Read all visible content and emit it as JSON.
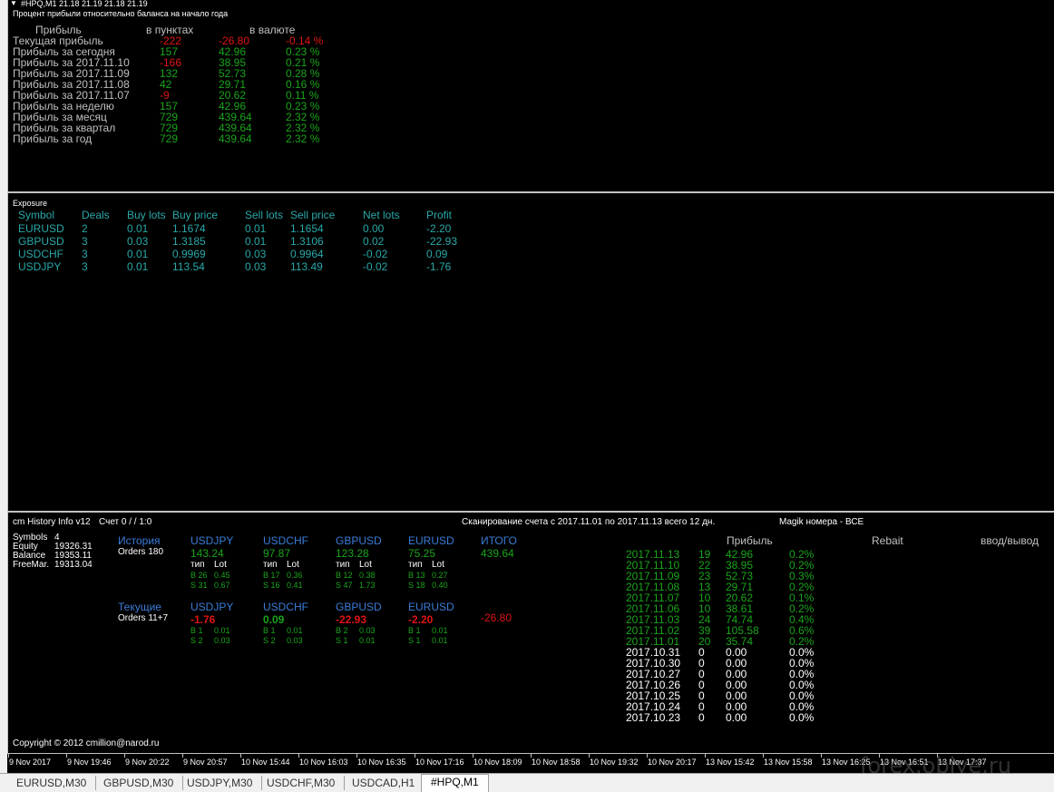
{
  "pane1": {
    "title": "#HPQ,M1  21.18 21.19 21.18 21.19",
    "subtitle": "Процент прибыли относительно баланса на начало года",
    "col_profit": "Прибыль",
    "col_points": "в пунктах",
    "col_currency": "в валюте",
    "rows": [
      {
        "label": "Текущая прибыль",
        "points": "-222",
        "money": "-26.80",
        "pct": "-0.14 %",
        "neg": true
      },
      {
        "label": "Прибыль за сегодня",
        "points": "157",
        "money": "42.96",
        "pct": "0.23 %",
        "neg": false
      },
      {
        "label": "Прибыль за 2017.11.10",
        "points": "-166",
        "money": "38.95",
        "pct": "0.21 %",
        "neg": false,
        "neg_points": true
      },
      {
        "label": "Прибыль за 2017.11.09",
        "points": "132",
        "money": "52.73",
        "pct": "0.28 %",
        "neg": false
      },
      {
        "label": "Прибыль за 2017.11.08",
        "points": "42",
        "money": "29.71",
        "pct": "0.16 %",
        "neg": false
      },
      {
        "label": "Прибыль за 2017.11.07",
        "points": "-9",
        "money": "20.62",
        "pct": "0.11 %",
        "neg": false,
        "neg_points": true
      },
      {
        "label": "Прибыль за неделю",
        "points": "157",
        "money": "42.96",
        "pct": "0.23 %",
        "neg": false
      },
      {
        "label": "Прибыль за месяц",
        "points": "729",
        "money": "439.64",
        "pct": "2.32 %",
        "neg": false
      },
      {
        "label": "Прибыль за квартал",
        "points": "729",
        "money": "439.64",
        "pct": "2.32 %",
        "neg": false
      },
      {
        "label": "Прибыль за год",
        "points": "729",
        "money": "439.64",
        "pct": "2.32 %",
        "neg": false
      }
    ]
  },
  "pane2": {
    "title": "Exposure",
    "headers": [
      "Symbol",
      "Deals",
      "Buy lots",
      "Buy price",
      "Sell lots",
      "Sell price",
      "Net lots",
      "Profit"
    ],
    "rows": [
      [
        "EURUSD",
        "2",
        "0.01",
        "1.1674",
        "0.01",
        "1.1654",
        "0.00",
        "-2.20"
      ],
      [
        "GBPUSD",
        "3",
        "0.03",
        "1.3185",
        "0.01",
        "1.3106",
        "0.02",
        "-22.93"
      ],
      [
        "USDCHF",
        "3",
        "0.01",
        "0.9969",
        "0.03",
        "0.9964",
        "-0.02",
        "0.09"
      ],
      [
        "USDJPY",
        "3",
        "0.01",
        "113.54",
        "0.03",
        "113.49",
        "-0.02",
        "-1.76"
      ]
    ]
  },
  "pane3": {
    "title": "cm History Info v12",
    "counter": "Счет 0 /  / 1:0",
    "scan": "Сканирование счета с 2017.11.01 по 2017.11.13 всего 12 дн.",
    "magic": "Magik номера - ВСЕ",
    "account": [
      {
        "label": "Symbols",
        "value": "4"
      },
      {
        "label": "Equity",
        "value": "19326.31"
      },
      {
        "label": "Balance",
        "value": "19353.11"
      },
      {
        "label": "FreeMar.",
        "value": "19313.04"
      }
    ],
    "history_label": "История",
    "history_orders": "Orders 180",
    "current_label": "Текущие",
    "current_orders": "Orders 11+7",
    "type_label": "тип",
    "lot_label": "Lot",
    "total_label": "ИТОГО",
    "history_total": "439.64",
    "current_total": "-26.80",
    "history": [
      {
        "sym": "USDJPY",
        "profit": "143.24",
        "b": "B 26",
        "bl": "0.45",
        "s": "S 31",
        "sl": "0.67"
      },
      {
        "sym": "USDCHF",
        "profit": "97.87",
        "b": "B 17",
        "bl": "0.36",
        "s": "S 16",
        "sl": "0.41"
      },
      {
        "sym": "GBPUSD",
        "profit": "123.28",
        "b": "B 12",
        "bl": "0.38",
        "s": "S 47",
        "sl": "1.73"
      },
      {
        "sym": "EURUSD",
        "profit": "75.25",
        "b": "B 13",
        "bl": "0.27",
        "s": "S 18",
        "sl": "0.40"
      }
    ],
    "current": [
      {
        "sym": "USDJPY",
        "profit": "-1.76",
        "neg": true,
        "b": "B 1",
        "bl": "0.01",
        "s": "S 2",
        "sl": "0.03"
      },
      {
        "sym": "USDCHF",
        "profit": "0.09",
        "neg": false,
        "b": "B 1",
        "bl": "0.01",
        "s": "S 2",
        "sl": "0.03"
      },
      {
        "sym": "GBPUSD",
        "profit": "-22.93",
        "neg": true,
        "b": "B 2",
        "bl": "0.03",
        "s": "S 1",
        "sl": "0.01"
      },
      {
        "sym": "EURUSD",
        "profit": "-2.20",
        "neg": true,
        "b": "B 1",
        "bl": "0.01",
        "s": "S 1",
        "sl": "0.01"
      }
    ],
    "daily_header": "Прибыль",
    "rebait": "Rebait",
    "inout": "ввод/вывод",
    "daily": [
      {
        "date": "2017.11.13",
        "n": "19",
        "profit": "42.96",
        "pct": "0.2%",
        "active": true
      },
      {
        "date": "2017.11.10",
        "n": "22",
        "profit": "38.95",
        "pct": "0.2%",
        "active": true
      },
      {
        "date": "2017.11.09",
        "n": "23",
        "profit": "52.73",
        "pct": "0.3%",
        "active": true
      },
      {
        "date": "2017.11.08",
        "n": "13",
        "profit": "29.71",
        "pct": "0.2%",
        "active": true
      },
      {
        "date": "2017.11.07",
        "n": "10",
        "profit": "20.62",
        "pct": "0.1%",
        "active": true
      },
      {
        "date": "2017.11.06",
        "n": "10",
        "profit": "38.61",
        "pct": "0.2%",
        "active": true
      },
      {
        "date": "2017.11.03",
        "n": "24",
        "profit": "74.74",
        "pct": "0.4%",
        "active": true
      },
      {
        "date": "2017.11.02",
        "n": "39",
        "profit": "105.58",
        "pct": "0.6%",
        "active": true
      },
      {
        "date": "2017.11.01",
        "n": "20",
        "profit": "35.74",
        "pct": "0.2%",
        "active": true
      },
      {
        "date": "2017.10.31",
        "n": "0",
        "profit": "0.00",
        "pct": "0.0%",
        "active": false
      },
      {
        "date": "2017.10.30",
        "n": "0",
        "profit": "0.00",
        "pct": "0.0%",
        "active": false
      },
      {
        "date": "2017.10.27",
        "n": "0",
        "profit": "0.00",
        "pct": "0.0%",
        "active": false
      },
      {
        "date": "2017.10.26",
        "n": "0",
        "profit": "0.00",
        "pct": "0.0%",
        "active": false
      },
      {
        "date": "2017.10.25",
        "n": "0",
        "profit": "0.00",
        "pct": "0.0%",
        "active": false
      },
      {
        "date": "2017.10.24",
        "n": "0",
        "profit": "0.00",
        "pct": "0.0%",
        "active": false
      },
      {
        "date": "2017.10.23",
        "n": "0",
        "profit": "0.00",
        "pct": "0.0%",
        "active": false
      }
    ],
    "copyright": "Copyright © 2012 cmillion@narod.ru"
  },
  "timeaxis": [
    "9 Nov 2017",
    "9 Nov 19:46",
    "9 Nov 20:22",
    "9 Nov 20:57",
    "10 Nov 15:44",
    "10 Nov 16:03",
    "10 Nov 16:35",
    "10 Nov 17:16",
    "10 Nov 18:09",
    "10 Nov 18:58",
    "10 Nov 19:32",
    "10 Nov 20:17",
    "13 Nov 15:42",
    "13 Nov 15:58",
    "13 Nov 16:25",
    "13 Nov 16:51",
    "13 Nov 17:37"
  ],
  "tabs": [
    "EURUSD,M30",
    "GBPUSD,M30",
    "USDJPY,M30",
    "USDCHF,M30",
    "USDCAD,H1",
    "#HPQ,M1"
  ],
  "active_tab": "#HPQ,M1",
  "watermark": "forex.obiye.ru",
  "colors": {
    "green": "#1aa51a",
    "red": "#e01414",
    "teal": "#2aa8a8",
    "blue": "#3a7cd8",
    "grey": "#c0c0c0"
  }
}
